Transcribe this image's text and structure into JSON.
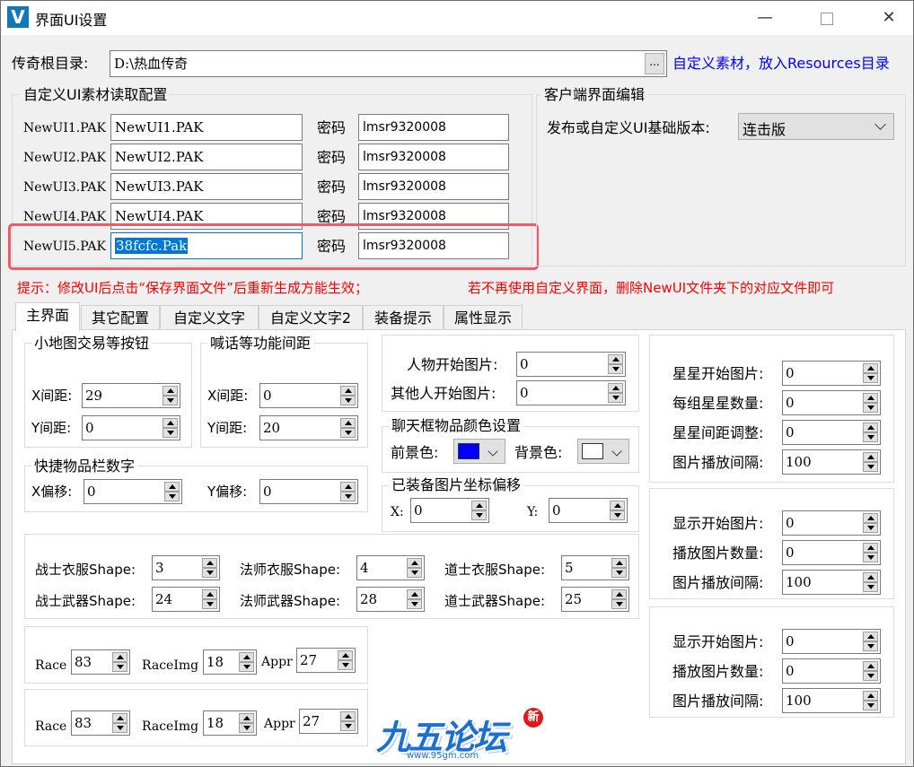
{
  "window": {
    "title": "界面UI设置",
    "minimize": "—",
    "maximize": "☐",
    "close": "✕"
  },
  "root_dir": {
    "label": "传奇根目录:",
    "value": "D:\\热血传奇",
    "browse": "...",
    "hint": "自定义素材，放入Resources目录"
  },
  "pak_group": {
    "title": "自定义UI素材读取配置",
    "password_label": "密码",
    "rows": [
      {
        "label": "NewUI1.PAK",
        "file": "NewUI1.PAK",
        "password": "lmsr9320008"
      },
      {
        "label": "NewUI2.PAK",
        "file": "NewUI2.PAK",
        "password": "lmsr9320008"
      },
      {
        "label": "NewUI3.PAK",
        "file": "NewUI3.PAK",
        "password": "lmsr9320008"
      },
      {
        "label": "NewUI4.PAK",
        "file": "NewUI4.PAK",
        "password": "lmsr9320008"
      },
      {
        "label": "NewUI5.PAK",
        "file": "38fcfc.Pak",
        "password": "lmsr9320008"
      }
    ]
  },
  "client_group": {
    "title": "客户端界面编辑",
    "version_label": "发布或自定义UI基础版本:",
    "version_value": "连击版"
  },
  "tips": {
    "left": "提示：修改UI后点击“保存界面文件”后重新生成方能生效；",
    "right": "若不再使用自定义界面，删除NewUI文件夹下的对应文件即可"
  },
  "tabs": [
    "主界面",
    "其它配置",
    "自定义文字",
    "自定义文字2",
    "装备提示",
    "属性显示"
  ],
  "minimap": {
    "title": "小地图交易等按钮",
    "x_label": "X间距:",
    "x": "29",
    "y_label": "Y间距:",
    "y": "0"
  },
  "shout": {
    "title": "喊话等功能间距",
    "x_label": "X间距:",
    "x": "0",
    "y_label": "Y间距:",
    "y": "20"
  },
  "quickbar": {
    "title": "快捷物品栏数字",
    "x_label": "X偏移:",
    "x": "0",
    "y_label": "Y偏移:",
    "y": "0"
  },
  "char_img": {
    "self_label": "人物开始图片:",
    "self": "0",
    "other_label": "其他人开始图片:",
    "other": "0"
  },
  "chat_color": {
    "title": "聊天框物品颜色设置",
    "fg_label": "前景色:",
    "bg_label": "背景色:",
    "fg_color": "#0000ff",
    "bg_color": "#ffffff"
  },
  "equip_offset": {
    "title": "已装备图片坐标偏移",
    "x_label": "X:",
    "x": "0",
    "y_label": "Y:",
    "y": "0"
  },
  "shapes": {
    "warrior_dress_label": "战士衣服Shape:",
    "warrior_dress": "3",
    "mage_dress_label": "法师衣服Shape:",
    "mage_dress": "4",
    "taoist_dress_label": "道士衣服Shape:",
    "taoist_dress": "5",
    "warrior_weapon_label": "战士武器Shape:",
    "warrior_weapon": "24",
    "mage_weapon_label": "法师武器Shape:",
    "mage_weapon": "28",
    "taoist_weapon_label": "道士武器Shape:",
    "taoist_weapon": "25"
  },
  "race1": {
    "race_label": "Race",
    "race": "83",
    "raceimg_label": "RaceImg",
    "raceimg": "18",
    "appr_label": "Appr",
    "appr": "27"
  },
  "race2": {
    "race_label": "Race",
    "race": "83",
    "raceimg_label": "RaceImg",
    "raceimg": "18",
    "appr_label": "Appr",
    "appr": "27"
  },
  "stars": {
    "start_label": "星星开始图片:",
    "start": "0",
    "count_label": "每组星星数量:",
    "count": "0",
    "gap_label": "星星间距调整:",
    "gap": "0",
    "interval_label": "图片播放间隔:",
    "interval": "100"
  },
  "display1": {
    "start_label": "显示开始图片:",
    "start": "0",
    "count_label": "播放图片数量:",
    "count": "0",
    "interval_label": "图片播放间隔:",
    "interval": "100"
  },
  "display2": {
    "start_label": "显示开始图片:",
    "start": "0",
    "count_label": "播放图片数量:",
    "count": "0",
    "interval_label": "图片播放间隔:",
    "interval": "100"
  },
  "watermark": {
    "logo": "九五论坛",
    "badge": "新",
    "url": "www.95gm.com"
  }
}
